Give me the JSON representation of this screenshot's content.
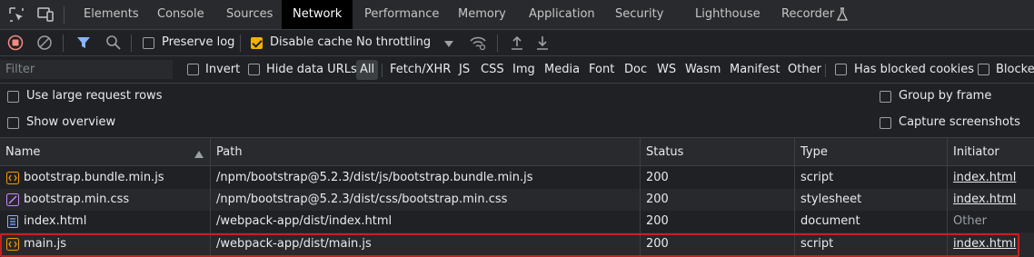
{
  "tabs": [
    {
      "label": "Elements"
    },
    {
      "label": "Console"
    },
    {
      "label": "Sources"
    },
    {
      "label": "Network"
    },
    {
      "label": "Performance"
    },
    {
      "label": "Memory"
    },
    {
      "label": "Application"
    },
    {
      "label": "Security"
    },
    {
      "label": "Lighthouse"
    },
    {
      "label": "Recorder"
    }
  ],
  "toolbar": {
    "preserve_log": "Preserve log",
    "preserve_log_checked": false,
    "disable_cache": "Disable cache",
    "disable_cache_checked": true,
    "throttling": "No throttling"
  },
  "filter": {
    "placeholder": "Filter",
    "invert": "Invert",
    "hide_data_urls": "Hide data URLs",
    "types": [
      "All",
      "Fetch/XHR",
      "JS",
      "CSS",
      "Img",
      "Media",
      "Font",
      "Doc",
      "WS",
      "Wasm",
      "Manifest",
      "Other"
    ],
    "active_type": "All",
    "has_blocked_cookies": "Has blocked cookies",
    "blocked_requests": "Blocked"
  },
  "settings": {
    "large_rows": "Use large request rows",
    "show_overview": "Show overview",
    "group_by_frame": "Group by frame",
    "capture_screenshots": "Capture screenshots"
  },
  "table": {
    "columns": [
      "Name",
      "Path",
      "Status",
      "Type",
      "Initiator"
    ],
    "rows": [
      {
        "name": "bootstrap.bundle.min.js",
        "path": "/npm/bootstrap@5.2.3/dist/js/bootstrap.bundle.min.js",
        "status": "200",
        "type": "script",
        "initiator": "index.html",
        "icon": "script-file-icon"
      },
      {
        "name": "bootstrap.min.css",
        "path": "/npm/bootstrap@5.2.3/dist/css/bootstrap.min.css",
        "status": "200",
        "type": "stylesheet",
        "initiator": "index.html",
        "icon": "stylesheet-file-icon"
      },
      {
        "name": "index.html",
        "path": "/webpack-app/dist/index.html",
        "status": "200",
        "type": "document",
        "initiator": "Other",
        "icon": "document-file-icon"
      },
      {
        "name": "main.js",
        "path": "/webpack-app/dist/main.js",
        "status": "200",
        "type": "script",
        "initiator": "index.html",
        "icon": "script-file-icon"
      }
    ]
  },
  "colors": {
    "accent": "#8ab4f8",
    "record_red": "#f28b82",
    "checkbox_checked": "#f6b100",
    "script_icon": "#f29900",
    "stylesheet_icon": "#c58af9",
    "document_icon": "#8ab4f8",
    "highlight_border": "#c5221f"
  }
}
